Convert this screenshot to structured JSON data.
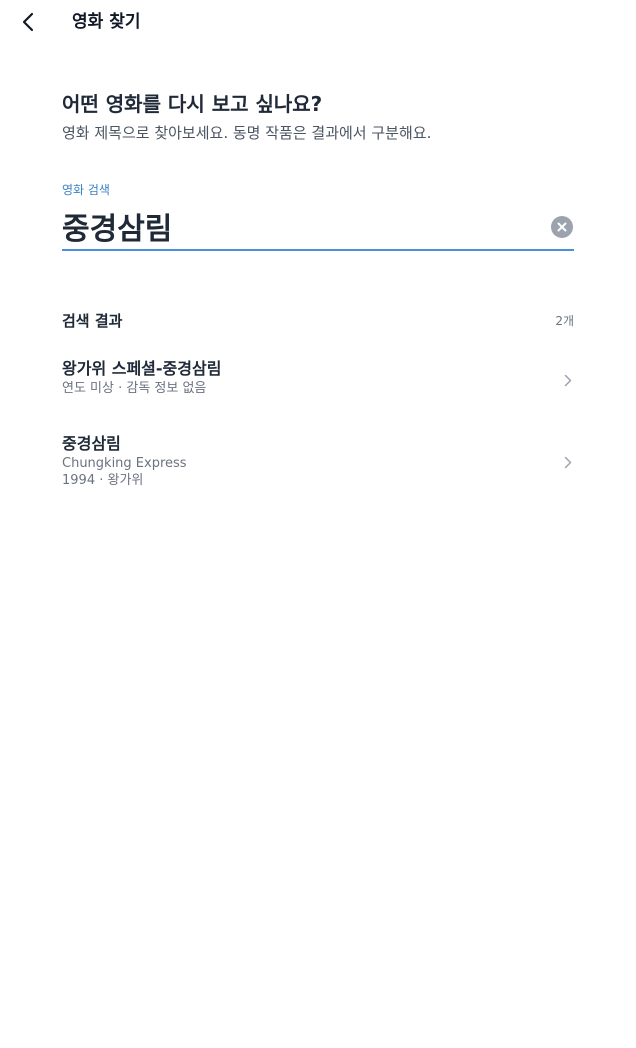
{
  "header": {
    "title": "영화 찾기",
    "back_icon": "chevron-left-icon"
  },
  "intro": {
    "title": "어떤 영화를 다시 보고 싶나요?",
    "subtitle": "영화 제목으로 찾아보세요. 동명 작품은 결과에서 구분해요."
  },
  "search": {
    "label": "영화 검색",
    "value": "중경삼림",
    "clear_icon": "close-circle-icon",
    "accent_color": "#4a90d9"
  },
  "results": {
    "title": "검색 결과",
    "count": "2개",
    "items": [
      {
        "title": "왕가위 스페셜-중경삼림",
        "meta": "연도 미상 · 감독 정보 없음"
      },
      {
        "title": "중경삼림",
        "subtitle": "Chungking Express",
        "meta": "1994 · 왕가위"
      }
    ]
  }
}
